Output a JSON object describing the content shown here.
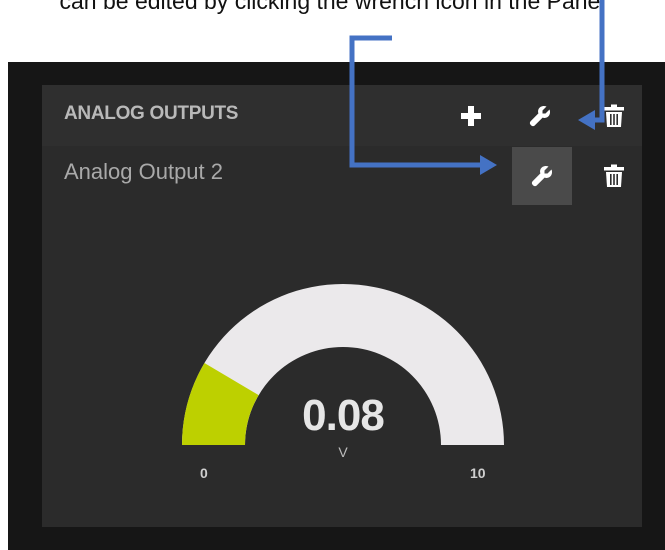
{
  "caption": {
    "text": "can be edited by clicking the wrench icon in the Panel"
  },
  "panel": {
    "title": "ANALOG OUTPUTS",
    "icons": {
      "add": "plus-icon",
      "settings": "wrench-icon",
      "delete": "trash-icon"
    }
  },
  "widget": {
    "name": "Analog Output 2",
    "icons": {
      "settings": "wrench-icon",
      "delete": "trash-icon"
    },
    "gauge": {
      "value": "0.08",
      "unit": "V",
      "min": "0",
      "max": "10",
      "fill_fraction": 0.17
    }
  },
  "colors": {
    "background": "#161616",
    "panel": "#2b2b2b",
    "gauge_track": "#ebe9eb",
    "gauge_fill": "#bdd000",
    "annotation_arrow": "#4472c4"
  }
}
